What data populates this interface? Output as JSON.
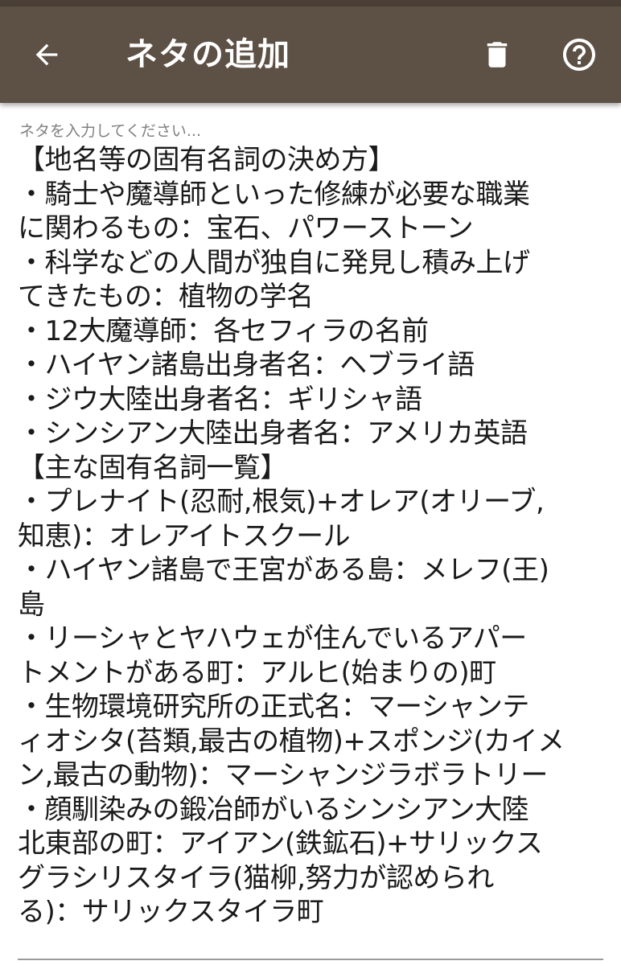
{
  "app_bar": {
    "title": "ネタの追加",
    "back_icon": "arrow-left-icon",
    "delete_icon": "trash-icon",
    "help_icon": "help-circle-icon",
    "background_color": "#5d5045"
  },
  "editor": {
    "hint": "ネタを入力してください...",
    "value": "【地名等の固有名詞の決め方】\n・騎士や魔導師といった修練が必要な職業\nに関わるもの：宝石、パワーストーン\n・科学などの人間が独自に発見し積み上げ\nてきたもの：植物の学名\n・12大魔導師：各セフィラの名前\n・ハイヤン諸島出身者名：ヘブライ語\n・ジウ大陸出身者名：ギリシャ語\n・シンシアン大陸出身者名：アメリカ英語\n【主な固有名詞一覧】\n・プレナイト(忍耐,根気)+オレア(オリーブ,\n知恵)：オレアイトスクール\n・ハイヤン諸島で王宮がある島：メレフ(王)\n島\n・リーシャとヤハウェが住んでいるアパー\nトメントがある町：アルヒ(始まりの)町\n・生物環境研究所の正式名：マーシャンテ\nィオシタ(苔類,最古の植物)+スポンジ(カイメ\nン,最古の動物)：マーシャンジラボラトリー\n・顔馴染みの鍛冶師がいるシンシアン大陸\n北東部の町：アイアン(鉄鉱石)+サリックス\nグラシリスタイラ(猫柳,努力が認められ\nる)：サリックスタイラ町"
  }
}
